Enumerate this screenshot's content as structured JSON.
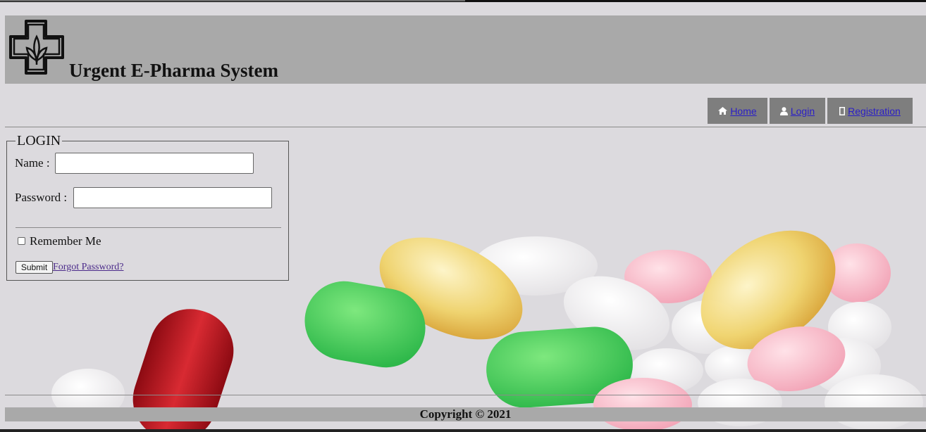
{
  "header": {
    "title": "Urgent E-Pharma System",
    "logo_icon": "pharmacy-cross-icon"
  },
  "nav": {
    "items": [
      {
        "label": " Home",
        "icon": "home-icon"
      },
      {
        "label": " Login",
        "icon": "user-icon"
      },
      {
        "label": " Registration",
        "icon": "mobile-icon"
      }
    ]
  },
  "login": {
    "legend": "LOGIN",
    "name_label": "Name :",
    "name_value": "",
    "password_label": "Password :",
    "password_value": "",
    "remember_label": "Remember Me",
    "remember_checked": false,
    "submit_label": "Submit",
    "forgot_label": "Forgot Password?"
  },
  "footer": {
    "copyright": "Copyright © 2021"
  },
  "colors": {
    "header_bg": "#a9a9a9",
    "nav_bg": "#7e7e7e",
    "page_bg": "#dcdade",
    "link": "#2a1ec7"
  }
}
